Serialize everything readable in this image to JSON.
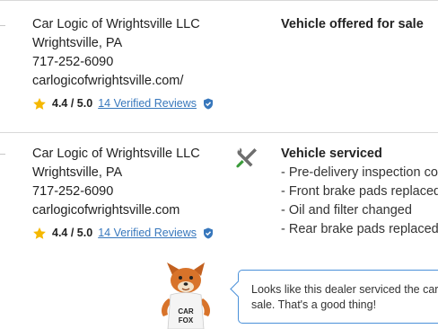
{
  "records": [
    {
      "dealer": {
        "name": "Car Logic of Wrightsville LLC",
        "location": "Wrightsville, PA",
        "phone": "717-252-6090",
        "website": "carlogicofwrightsville.com/"
      },
      "rating": {
        "score": "4.4 / 5.0",
        "reviews_link": "14 Verified Reviews"
      },
      "event": {
        "title": "Vehicle offered for sale"
      }
    },
    {
      "dealer": {
        "name": "Car Logic of Wrightsville LLC",
        "location": "Wrightsville, PA",
        "phone": "717-252-6090",
        "website": "carlogicofwrightsville.com"
      },
      "rating": {
        "score": "4.4 / 5.0",
        "reviews_link": "14 Verified Reviews"
      },
      "event": {
        "title": "Vehicle serviced",
        "items": [
          "- Pre-delivery inspection com",
          "- Front brake pads replaced",
          "- Oil and filter changed",
          "- Rear brake pads replaced"
        ]
      }
    }
  ],
  "tip": {
    "message_line1": "Looks like this dealer serviced the car",
    "message_line2": "sale. That's a good thing!",
    "mascot_shirt_text": "CAR FOX"
  },
  "colors": {
    "link": "#3777bc",
    "star": "#f5b800",
    "badge": "#3777bc",
    "tools_green": "#3a9b3a",
    "bubble_border": "#4a90d9"
  }
}
